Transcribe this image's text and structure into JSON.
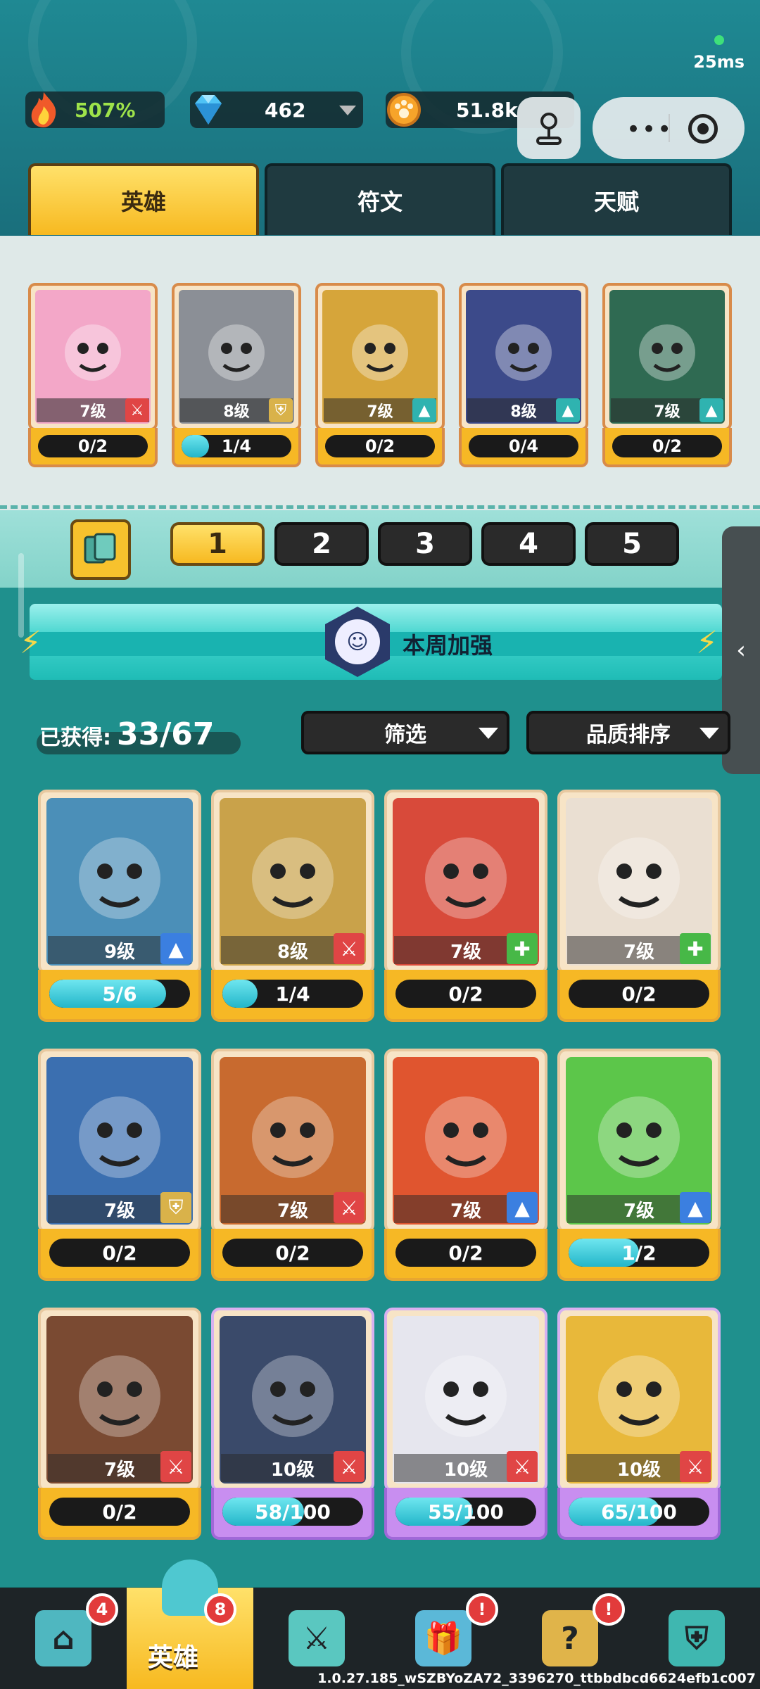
{
  "status": {
    "ping": "25ms"
  },
  "resources": {
    "power": {
      "icon": "flame-icon",
      "value": "507%"
    },
    "gems": {
      "icon": "diamond-icon",
      "value": "462"
    },
    "coins": {
      "icon": "paw-coin-icon",
      "value": "51.8k"
    }
  },
  "main_tabs": [
    {
      "label": "英雄",
      "active": true
    },
    {
      "label": "符文",
      "active": false
    },
    {
      "label": "天赋",
      "active": false
    }
  ],
  "team": [
    {
      "level": "7级",
      "progress": "0/2",
      "fill": 0,
      "badge": "sword-icon",
      "color": "#f3a7c8"
    },
    {
      "level": "8级",
      "progress": "1/4",
      "fill": 0.25,
      "badge": "shield-icon",
      "color": "#8b8f96"
    },
    {
      "level": "7级",
      "progress": "0/2",
      "fill": 0,
      "badge": "arrow-up-icon",
      "color": "#d6a53a"
    },
    {
      "level": "8级",
      "progress": "0/4",
      "fill": 0,
      "badge": "arrow-up-icon",
      "color": "#3c4a8a"
    },
    {
      "level": "7级",
      "progress": "0/2",
      "fill": 0,
      "badge": "arrow-up-icon",
      "color": "#2f6a52"
    }
  ],
  "deck_tabs": [
    "1",
    "2",
    "3",
    "4",
    "5"
  ],
  "banner": {
    "text": "本周加强"
  },
  "owned": {
    "label": "已获得:",
    "count": "33/67"
  },
  "filters": {
    "filter": "筛选",
    "sort": "品质排序"
  },
  "heroes": [
    {
      "level": "9级",
      "progress": "5/6",
      "fill": 0.83,
      "badge": "blue",
      "rarity": "gold",
      "color": "#4b8fb8"
    },
    {
      "level": "8级",
      "progress": "1/4",
      "fill": 0.25,
      "badge": "red",
      "rarity": "gold",
      "color": "#c9a24a"
    },
    {
      "level": "7级",
      "progress": "0/2",
      "fill": 0,
      "badge": "green",
      "rarity": "gold",
      "color": "#d84a3a"
    },
    {
      "level": "7级",
      "progress": "0/2",
      "fill": 0,
      "badge": "green",
      "rarity": "gold",
      "color": "#eadfd2"
    },
    {
      "level": "7级",
      "progress": "0/2",
      "fill": 0,
      "badge": "gold",
      "rarity": "gold",
      "color": "#3b6fb0"
    },
    {
      "level": "7级",
      "progress": "0/2",
      "fill": 0,
      "badge": "red",
      "rarity": "gold",
      "color": "#c86a2f"
    },
    {
      "level": "7级",
      "progress": "0/2",
      "fill": 0,
      "badge": "blue",
      "rarity": "gold",
      "color": "#e0552f"
    },
    {
      "level": "7级",
      "progress": "1/2",
      "fill": 0.5,
      "badge": "blue",
      "rarity": "gold",
      "color": "#5cc64a"
    },
    {
      "level": "7级",
      "progress": "0/2",
      "fill": 0,
      "badge": "red",
      "rarity": "gold",
      "color": "#7a4a32"
    },
    {
      "level": "10级",
      "progress": "58/100",
      "fill": 0.58,
      "badge": "red",
      "rarity": "purple",
      "color": "#3a4a6a"
    },
    {
      "level": "10级",
      "progress": "55/100",
      "fill": 0.55,
      "badge": "red",
      "rarity": "purple",
      "color": "#e6e6ee"
    },
    {
      "level": "10级",
      "progress": "65/100",
      "fill": 0.65,
      "badge": "red",
      "rarity": "purple",
      "color": "#e8b83a"
    }
  ],
  "nav": [
    {
      "name": "shop",
      "icon": "store-icon",
      "badge": "4"
    },
    {
      "name": "heroes",
      "icon": "cat-icon",
      "label": "英雄",
      "badge": "8",
      "active": true
    },
    {
      "name": "battle",
      "icon": "swords-icon",
      "badge": ""
    },
    {
      "name": "gifts",
      "icon": "gift-icon",
      "badge": "!"
    },
    {
      "name": "quests",
      "icon": "question-card-icon",
      "badge": "!"
    },
    {
      "name": "guild",
      "icon": "cat-shield-icon",
      "badge": ""
    }
  ],
  "version": "1.0.27.185_wSZBYoZA72_3396270_ttbbdbcd6624efb1c007"
}
